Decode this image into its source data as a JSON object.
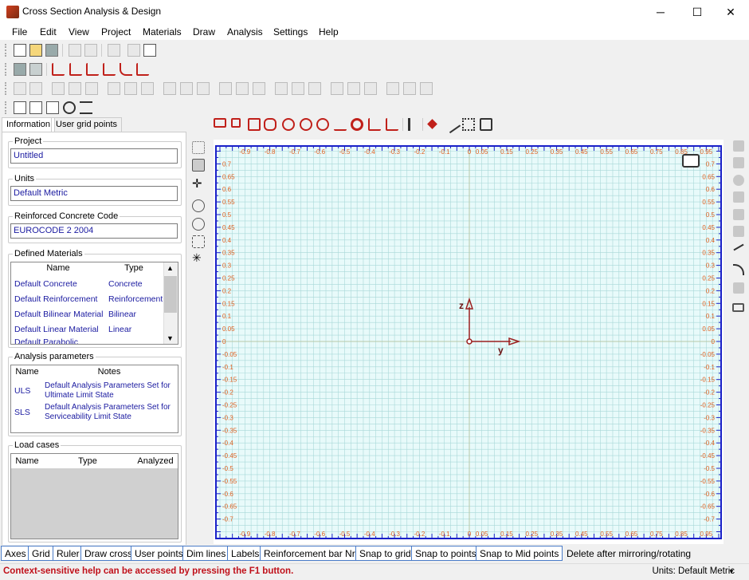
{
  "window": {
    "title": "Cross Section Analysis & Design",
    "minimize": "─",
    "maximize": "☐",
    "close": "✕"
  },
  "menu": [
    "File",
    "Edit",
    "View",
    "Project",
    "Materials",
    "Draw",
    "Analysis",
    "Settings",
    "Help"
  ],
  "tabs": [
    "Information",
    "User grid points"
  ],
  "project": {
    "label": "Project",
    "value": "Untitled"
  },
  "units": {
    "label": "Units",
    "value": "Default Metric"
  },
  "code": {
    "label": "Reinforced Concrete Code",
    "value": "EUROCODE 2 2004"
  },
  "materials": {
    "label": "Defined Materials",
    "headers": [
      "Name",
      "Type"
    ],
    "rows": [
      [
        "Default Concrete",
        "Concrete"
      ],
      [
        "Default Reinforcement",
        "Reinforcement"
      ],
      [
        "Default Bilinear Material",
        "Bilinear"
      ],
      [
        "Default Linear Material",
        "Linear"
      ],
      [
        "Default Parabolic",
        ""
      ]
    ]
  },
  "analysis": {
    "label": "Analysis parameters",
    "headers": [
      "Name",
      "Notes"
    ],
    "rows": [
      [
        "ULS",
        "Default Analysis Parameters Set for",
        "Ultimate Limit State"
      ],
      [
        "SLS",
        "Default Analysis Parameters Set for",
        "Serviceability Limit State"
      ]
    ]
  },
  "loadcases": {
    "label": "Load cases",
    "headers": [
      "Name",
      "Type",
      "Analyzed"
    ]
  },
  "canvas": {
    "x_ticks": [
      "-0.9",
      "-0.8",
      "-0.7",
      "-0.6",
      "-0.5",
      "-0.4",
      "-0.3",
      "-0.2",
      "-0.1",
      "0",
      "0.05",
      "0.15",
      "0.25",
      "0.35",
      "0.45",
      "0.55",
      "0.65",
      "0.75",
      "0.85",
      "0.95"
    ],
    "y_ticks": [
      "0.7",
      "0.65",
      "0.6",
      "0.55",
      "0.5",
      "0.45",
      "0.4",
      "0.35",
      "0.3",
      "0.25",
      "0.2",
      "0.15",
      "0.1",
      "0.05",
      "0",
      "-0.05",
      "-0.1",
      "-0.15",
      "-0.2",
      "-0.25",
      "-0.3",
      "-0.35",
      "-0.4",
      "-0.45",
      "-0.5",
      "-0.55",
      "-0.6",
      "-0.65",
      "-0.7"
    ],
    "axis_y_label": "y",
    "axis_z_label": "z",
    "colors": {
      "grid": "#a8d8d8",
      "bg": "#e8fafa",
      "axis": "#9b2020",
      "ruler": "#1a20c8",
      "tick_text": "#e06020"
    }
  },
  "bottom_buttons": [
    "Axes",
    "Grid",
    "Ruler",
    "Draw cross",
    "User points",
    "Dim lines",
    "Labels",
    "Reinforcement bar Nr.",
    "Snap to grid",
    "Snap to points",
    "Snap to Mid points",
    "Delete after mirroring/rotating"
  ],
  "status": {
    "help": "Context-sensitive help can be accessed by pressing the F1 button.",
    "units": "Units: Default Metric"
  }
}
